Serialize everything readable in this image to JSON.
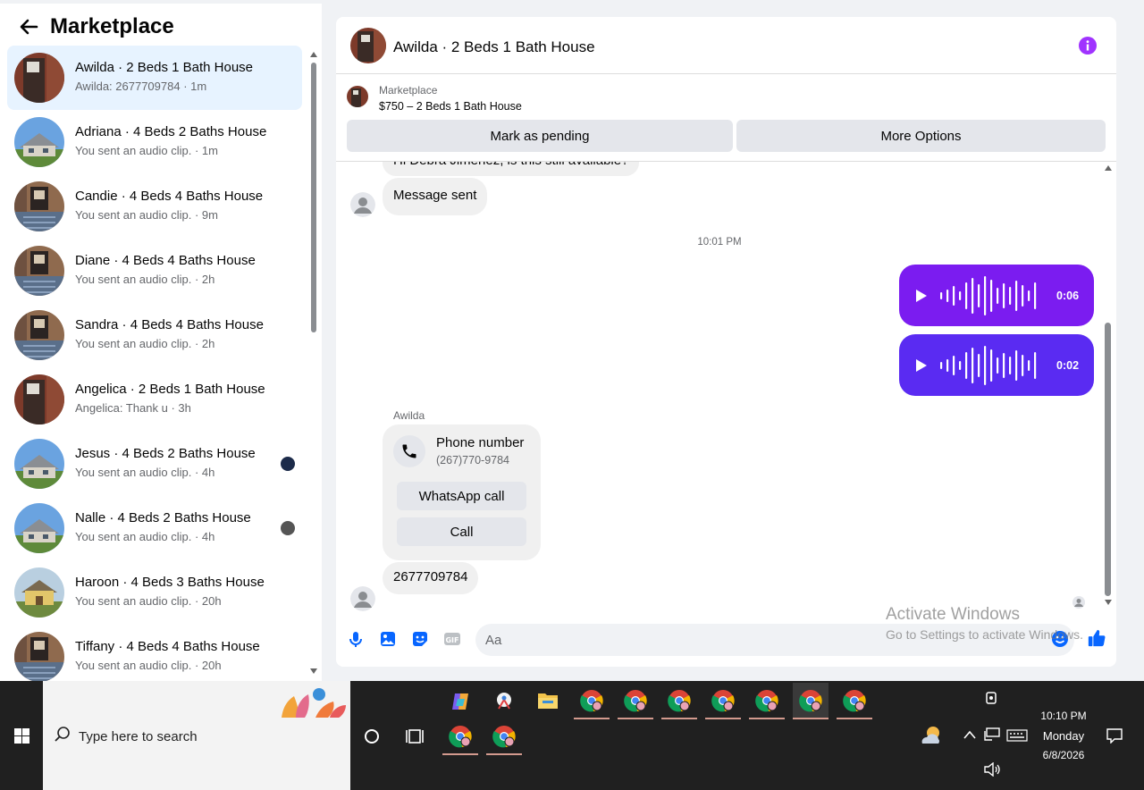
{
  "left": {
    "title": "Marketplace",
    "conversations": [
      {
        "name": "Awilda · 2 Beds 1 Bath House",
        "preview": "Awilda: 2677709784 · 1m",
        "thumb": "brick",
        "active": true
      },
      {
        "name": "Adriana · 4 Beds 2 Baths House",
        "preview": "You sent an audio clip. · 1m",
        "thumb": "house"
      },
      {
        "name": "Candie · 4 Beds 4 Baths House",
        "preview": "You sent an audio clip. · 9m",
        "thumb": "porch"
      },
      {
        "name": "Diane · 4 Beds 4 Baths House",
        "preview": "You sent an audio clip. · 2h",
        "thumb": "porch"
      },
      {
        "name": "Sandra · 4 Beds 4 Baths House",
        "preview": "You sent an audio clip. · 2h",
        "thumb": "porch"
      },
      {
        "name": "Angelica · 2 Beds 1 Bath House",
        "preview": "Angelica: Thank u · 3h",
        "thumb": "brick"
      },
      {
        "name": "Jesus · 4 Beds 2 Baths House",
        "preview": "You sent an audio clip. · 4h",
        "thumb": "house",
        "seen": "#1c2b4a"
      },
      {
        "name": "Nalle · 4 Beds 2 Baths House",
        "preview": "You sent an audio clip. · 4h",
        "thumb": "house",
        "seen": "#555"
      },
      {
        "name": "Haroon · 4 Beds 3 Baths House",
        "preview": "You sent an audio clip. · 20h",
        "thumb": "yellow"
      },
      {
        "name": "Tiffany · 4 Beds 4 Baths House",
        "preview": "You sent an audio clip. · 20h",
        "thumb": "porch"
      }
    ]
  },
  "chat": {
    "title": "Awilda · 2 Beds 1 Bath House",
    "listing": {
      "source": "Marketplace",
      "title": "$750 – 2 Beds 1 Bath House",
      "pending_label": "Mark as pending",
      "more_label": "More Options"
    },
    "messages": {
      "cut_text": "Hi Debra Jimenez, is this still available?",
      "sent_notice": "Message sent",
      "time": "10:01 PM",
      "audio": [
        {
          "duration": "0:06",
          "color": "#7b1cf0"
        },
        {
          "duration": "0:02",
          "color": "#5a2bf2"
        }
      ],
      "sender": "Awilda",
      "phone_card": {
        "title": "Phone number",
        "number": "(267)770-9784",
        "whatsapp_label": "WhatsApp call",
        "call_label": "Call"
      },
      "last_text": "2677709784"
    },
    "composer": {
      "placeholder": "Aa"
    }
  },
  "watermark": {
    "line1": "Activate Windows",
    "line2": "Go to Settings to activate Windows."
  },
  "taskbar": {
    "search_placeholder": "Type here to search",
    "time": "10:10 PM",
    "day": "Monday",
    "date": "6/8/2026"
  },
  "colors": {
    "accent": "#0866ff",
    "info": "#a033ff",
    "taskbar": "#202020"
  }
}
